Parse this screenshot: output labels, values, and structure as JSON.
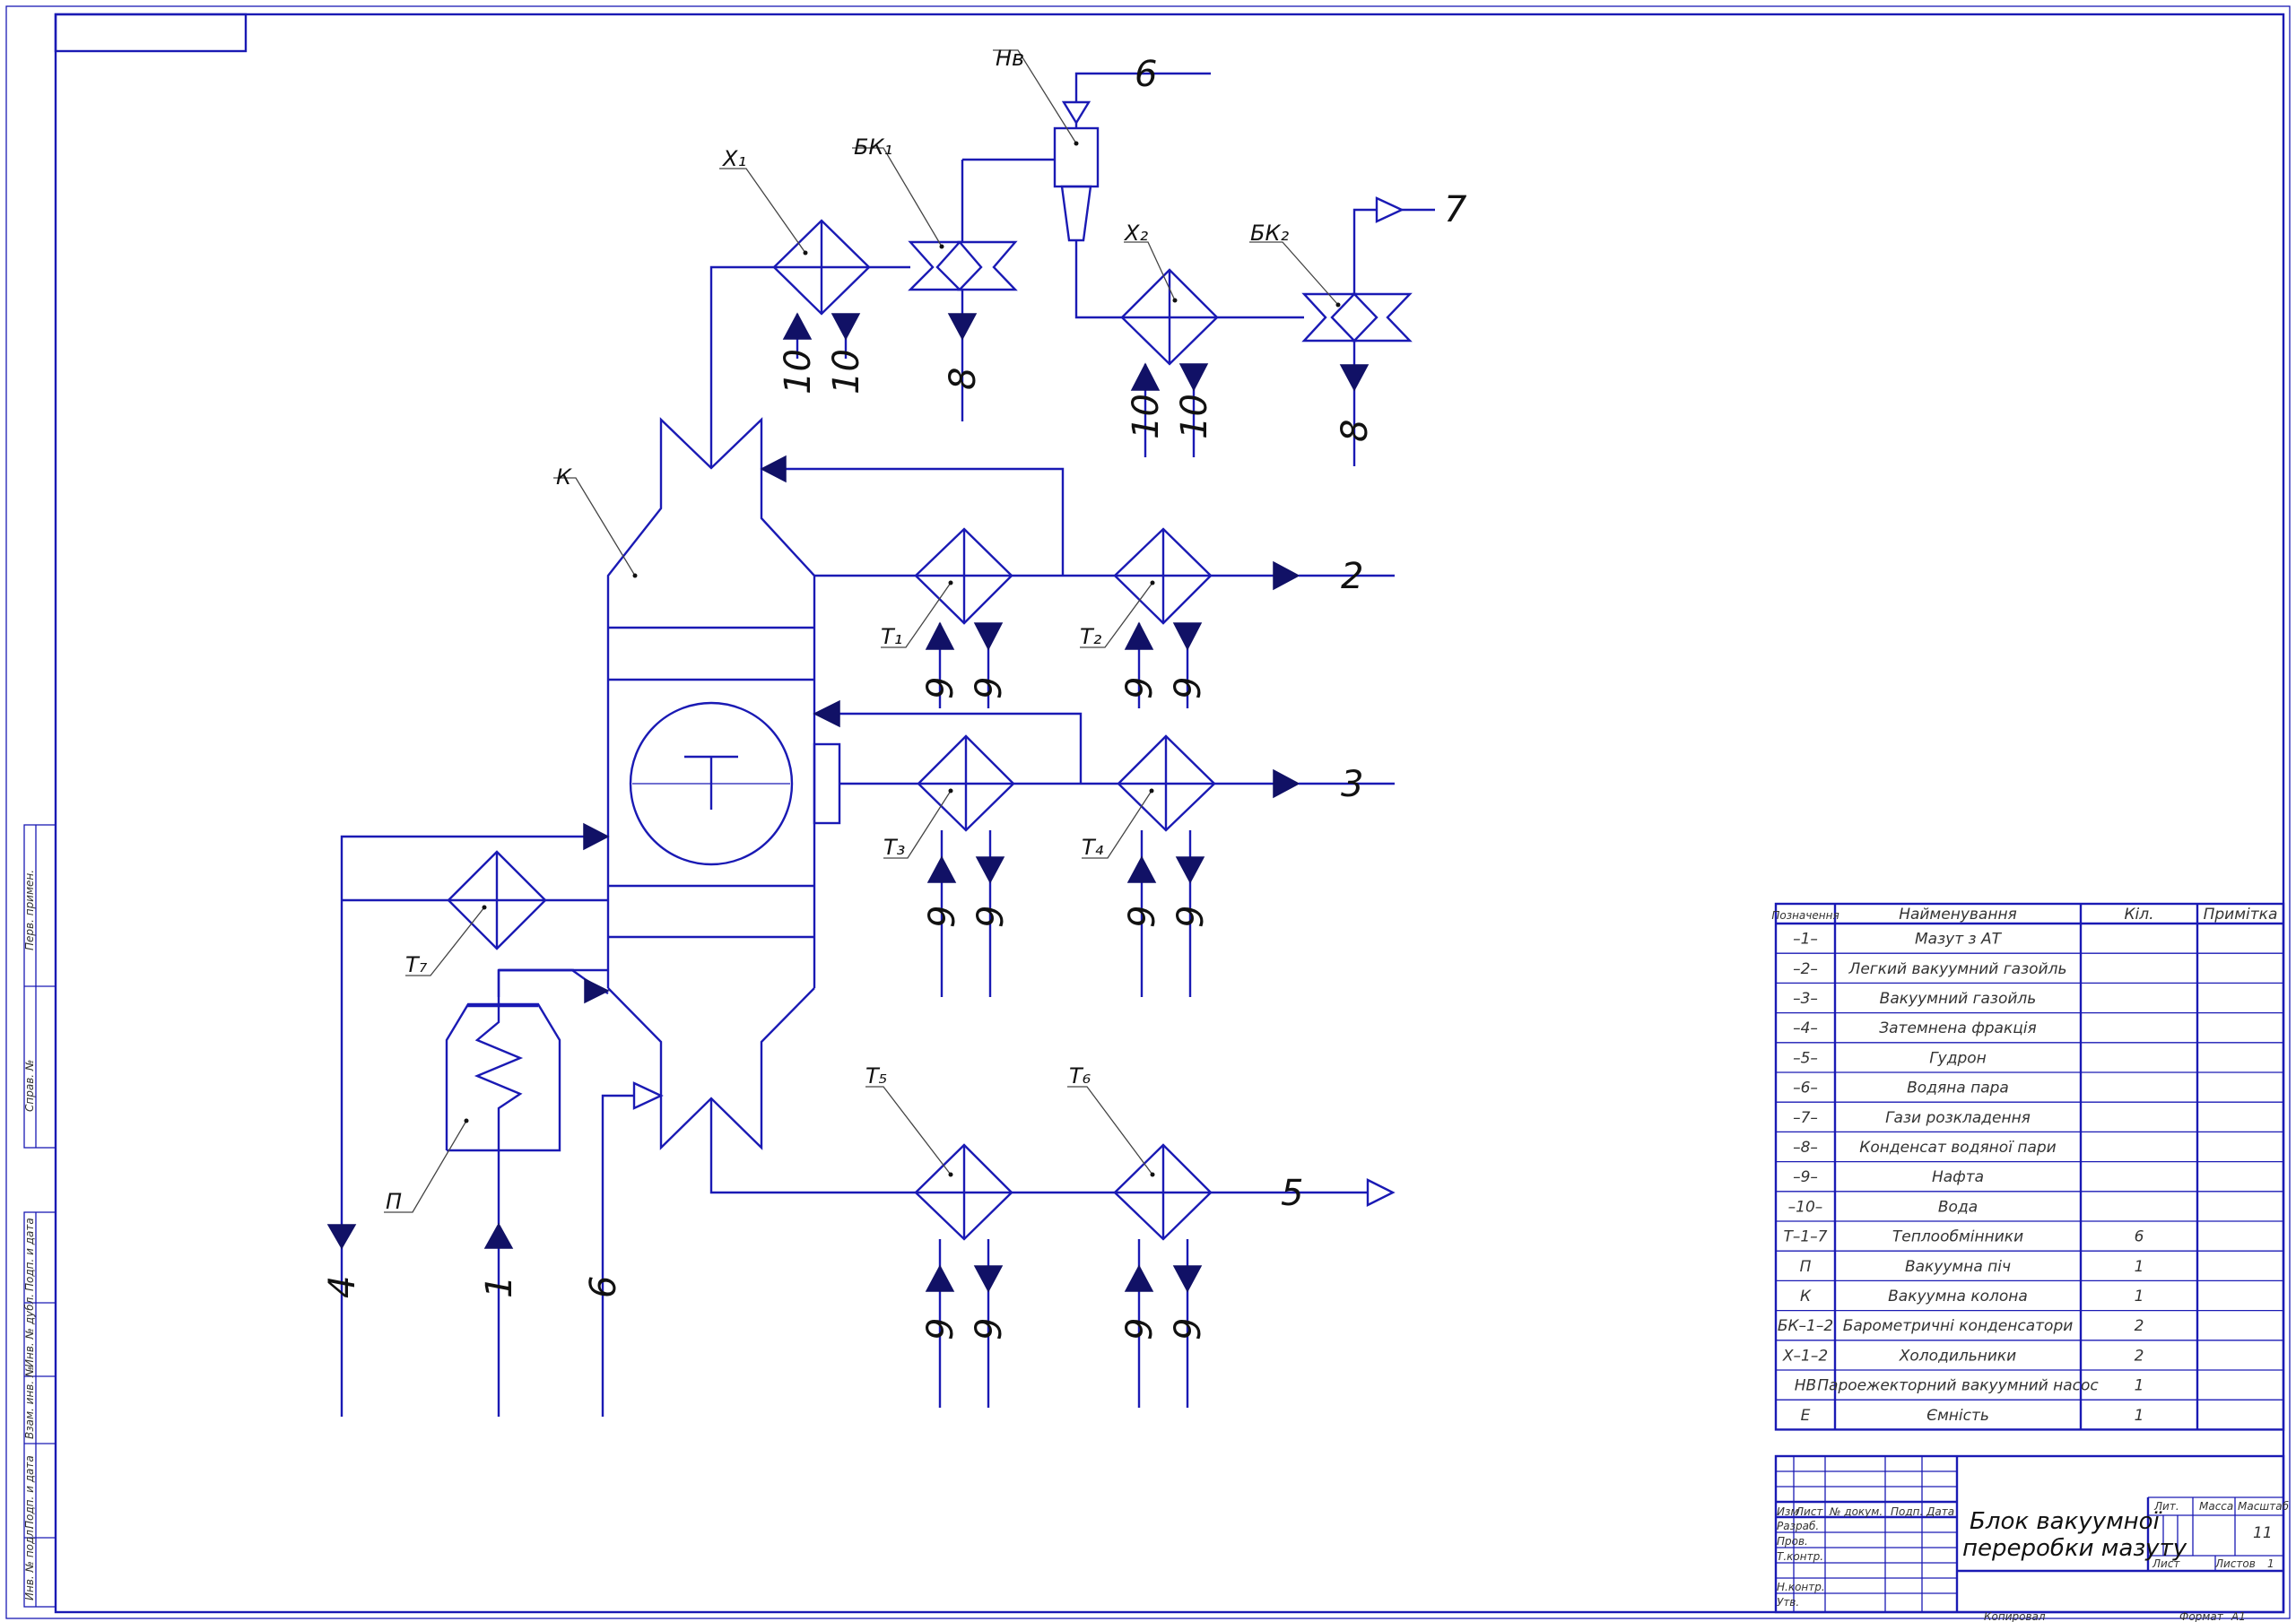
{
  "labels": {
    "column": "К",
    "furnace": "П",
    "ejector": "Нв",
    "x1": "Х₁",
    "x2": "Х₂",
    "bk1": "БК₁",
    "bk2": "БК₂",
    "t1": "Т₁",
    "t2": "Т₂",
    "t3": "Т₃",
    "t4": "Т₄",
    "t5": "Т₅",
    "t6": "Т₆",
    "t7": "Т₇"
  },
  "streams": {
    "s1": "1",
    "s2": "2",
    "s3": "3",
    "s4": "4",
    "s5": "5",
    "s6a": "6",
    "s6b": "6",
    "s7": "7",
    "s8a": "8",
    "s8b": "8",
    "s9": "9",
    "s10": "10"
  },
  "spec": {
    "headers": [
      "Позначення",
      "Найменування",
      "Кіл.",
      "Примітка"
    ],
    "rows": [
      [
        "–1–",
        "Мазут з АТ",
        "",
        ""
      ],
      [
        "–2–",
        "Легкий вакуумний газойль",
        "",
        ""
      ],
      [
        "–3–",
        "Вакуумний газойль",
        "",
        ""
      ],
      [
        "–4–",
        "Затемнена фракція",
        "",
        ""
      ],
      [
        "–5–",
        "Гудрон",
        "",
        ""
      ],
      [
        "–6–",
        "Водяна пара",
        "",
        ""
      ],
      [
        "–7–",
        "Гази розкладення",
        "",
        ""
      ],
      [
        "–8–",
        "Конденсат водяної пари",
        "",
        ""
      ],
      [
        "–9–",
        "Нафта",
        "",
        ""
      ],
      [
        "–10–",
        "Вода",
        "",
        ""
      ],
      [
        "Т–1–7",
        "Теплообмінники",
        "6",
        ""
      ],
      [
        "П",
        "Вакуумна піч",
        "1",
        ""
      ],
      [
        "К",
        "Вакуумна колона",
        "1",
        ""
      ],
      [
        "БК–1–2",
        "Барометричні конденсатори",
        "2",
        ""
      ],
      [
        "Х–1–2",
        "Холодильники",
        "2",
        ""
      ],
      [
        "НВ",
        "Пароежекторний вакуумний насос",
        "1",
        ""
      ],
      [
        "Е",
        "Ємність",
        "1",
        ""
      ]
    ]
  },
  "titleblock": {
    "title_line1": "Блок вакуумної",
    "title_line2": "переробки мазуту",
    "col_izm": "Изм",
    "col_list": "Лист",
    "col_doc": "№ докум.",
    "col_sign": "Подп.",
    "col_date": "Дата",
    "razrab": "Разраб.",
    "prov": "Пров.",
    "tkontr": "Т.контр.",
    "nkontr": "Н.контр.",
    "utv": "Утв.",
    "lit": "Лит.",
    "massa": "Масса",
    "masshtab": "Масштаб",
    "masshtab_val": "11",
    "sheet": "Лист",
    "sheets": "Листов",
    "sheets_val": "1",
    "copied": "Копировал",
    "format": "Формат",
    "format_val": "А1"
  },
  "sidestamp": {
    "perv": "Перв. примен.",
    "sprav": "Справ. №",
    "podp1": "Подп. и дата",
    "inv_dubl": "Инв. № дубл.",
    "vzam": "Взам. инв. №",
    "podp2": "Подп. и дата",
    "inv_podl": "Инв. № подл."
  },
  "colors": {
    "line": "#1a1ab4",
    "arrow": "#111166",
    "text": "#111111"
  }
}
